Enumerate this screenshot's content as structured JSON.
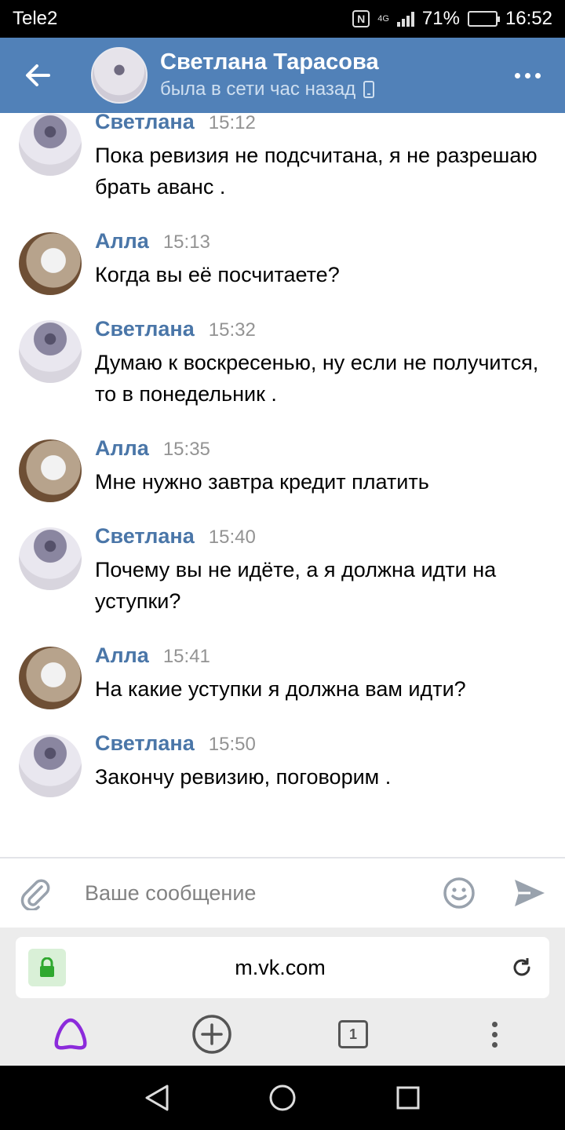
{
  "status_bar": {
    "carrier": "Tele2",
    "nfc": "N",
    "network": "4G",
    "battery": "71%",
    "battery_level": 0.71,
    "time": "16:52"
  },
  "header": {
    "name": "Светлана Тарасова",
    "status": "была в сети час назад",
    "back_icon": "arrow-left-icon",
    "more_icon": "more-horizontal-icon"
  },
  "messages": [
    {
      "author": "Светлана",
      "time": "15:12",
      "text": "Пока ревизия не подсчитана, я не разрешаю брать аванс ."
    },
    {
      "author": "Алла",
      "time": "15:13",
      "text": "Когда вы её посчитаете?"
    },
    {
      "author": "Светлана",
      "time": "15:32",
      "text": "Думаю к воскресенью, ну если не получится, то в понедельник ."
    },
    {
      "author": "Алла",
      "time": "15:35",
      "text": "Мне нужно завтра кредит платить"
    },
    {
      "author": "Светлана",
      "time": "15:40",
      "text": "Почему вы не идёте, а я должна идти на уступки?"
    },
    {
      "author": "Алла",
      "time": "15:41",
      "text": "На какие уступки я должна вам идти?"
    },
    {
      "author": "Светлана",
      "time": "15:50",
      "text": "Закончу ревизию, поговорим ."
    }
  ],
  "composer": {
    "placeholder": "Ваше сообщение",
    "attach_icon": "paperclip-icon",
    "emoji_icon": "smile-icon",
    "send_icon": "send-icon"
  },
  "browser": {
    "url": "m.vk.com",
    "tabs_count": "1",
    "colors": {
      "alice": "#8c2bdb",
      "lock_bg": "#d9f0d7",
      "lock": "#2fa82f"
    }
  },
  "colors": {
    "header_bg": "#5181b8",
    "author": "#4a76a8",
    "time": "#939393"
  }
}
